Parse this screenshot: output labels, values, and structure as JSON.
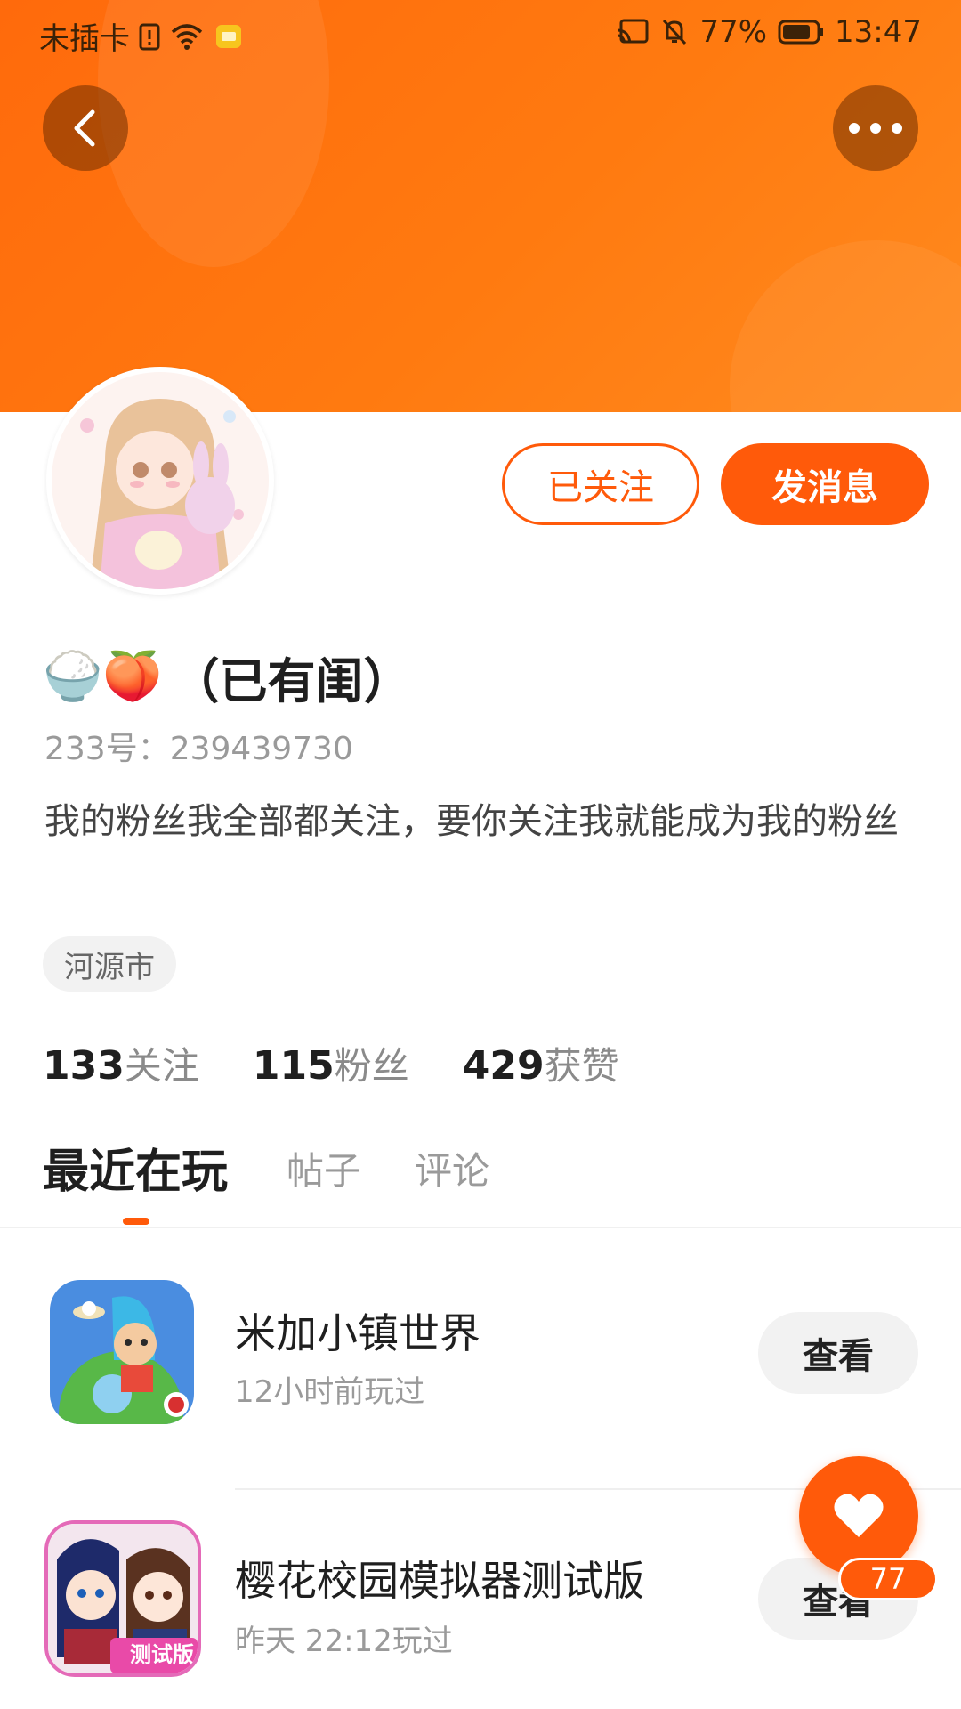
{
  "status_bar": {
    "carrier": "未插卡",
    "battery_percent": "77%",
    "time": "13:47",
    "icons": [
      "sim-alert-icon",
      "wifi-icon",
      "notification-icon",
      "cast-icon",
      "mute-icon",
      "battery-icon"
    ]
  },
  "colors": {
    "accent": "#ff5a0a",
    "header_gradient_start": "#ff6a0c",
    "header_gradient_end": "#ff8a1e"
  },
  "profile": {
    "name_emojis": "🍚🍑",
    "name_text": "（已有闺）",
    "user_id": "233号：239439730",
    "bio": "我的粉丝我全部都关注，要你关注我就能成为我的粉丝",
    "location": "河源市",
    "follow_button_label": "已关注",
    "message_button_label": "发消息"
  },
  "stats": [
    {
      "num": "133",
      "label": "关注"
    },
    {
      "num": "115",
      "label": "粉丝"
    },
    {
      "num": "429",
      "label": "获赞"
    }
  ],
  "tabs": [
    {
      "label": "最近在玩",
      "active": true
    },
    {
      "label": "帖子",
      "active": false
    },
    {
      "label": "评论",
      "active": false
    }
  ],
  "games": [
    {
      "title": "米加小镇世界",
      "subtitle": "12小时前玩过",
      "button": "查看"
    },
    {
      "title": "樱花校园模拟器测试版",
      "subtitle": "昨天 22:12玩过",
      "button": "查看",
      "icon_badge": "测试版"
    }
  ],
  "fab": {
    "count": "77"
  }
}
